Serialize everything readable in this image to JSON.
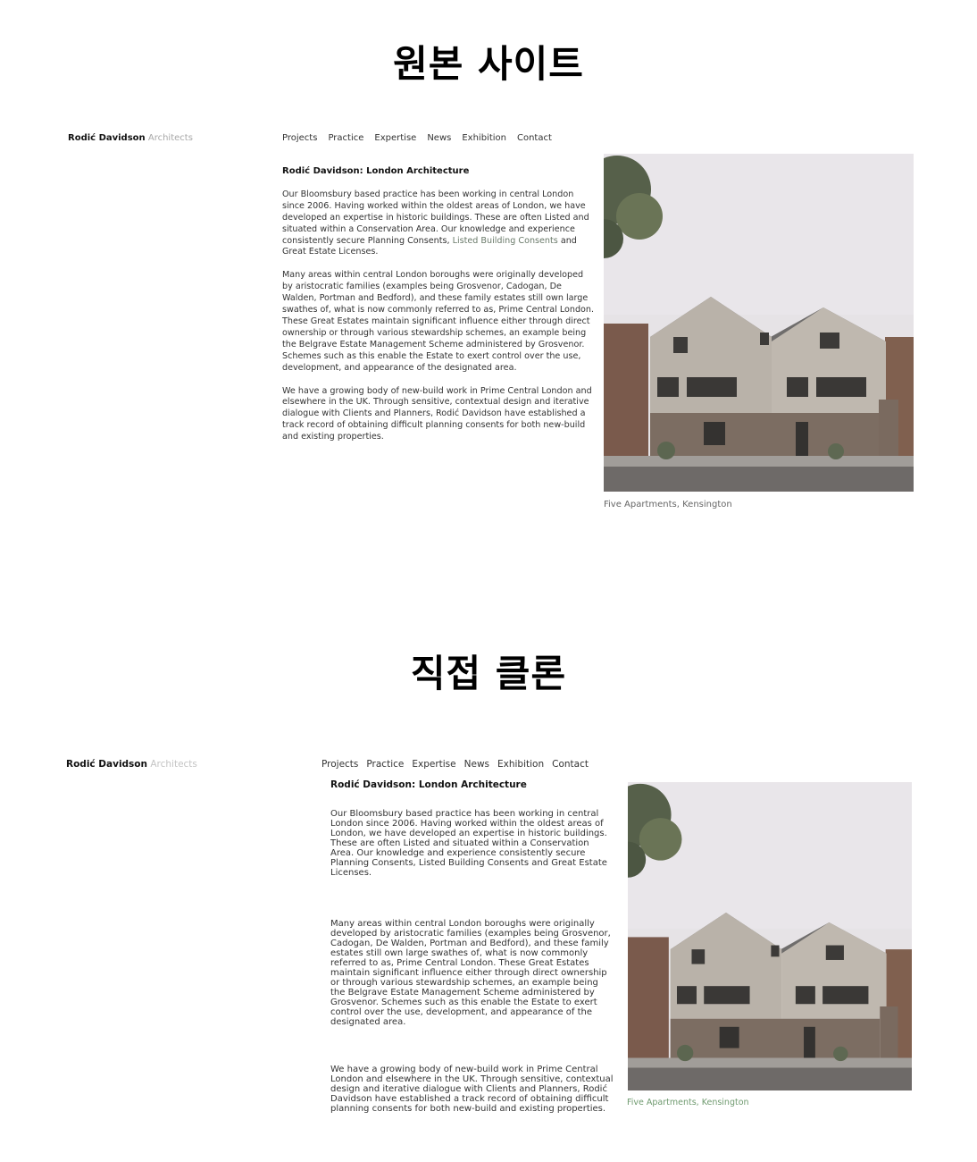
{
  "headings": {
    "original": "원본 사이트",
    "clone": "직접 클론"
  },
  "original": {
    "brand": {
      "name": "Rodić Davidson",
      "suffix": "Architects"
    },
    "nav": [
      "Projects",
      "Practice",
      "Expertise",
      "News",
      "Exhibition",
      "Contact"
    ],
    "article": {
      "title": "Rodić Davidson: London Architecture",
      "p1_before": "Our Bloomsbury based practice has been working in central London since 2006. Having worked within the oldest areas of London, we have developed an expertise in historic buildings. These are often Listed and situated within a Conservation Area. Our knowledge and experience consistently secure Planning Consents, ",
      "p1_link": "Listed Building Consents",
      "p1_after": " and Great Estate Licenses.",
      "p2": "Many areas within central London boroughs were originally developed by aristocratic families (examples being Grosvenor, Cadogan, De Walden, Portman and Bedford), and these family estates still own large swathes of, what is now commonly referred to as, Prime Central London. These Great Estates maintain significant influence either through direct ownership or through various stewardship schemes, an example being the Belgrave Estate Management Scheme administered by Grosvenor. Schemes such as this enable the Estate to exert control over the use, development, and appearance of the designated area.",
      "p3": "We have a growing body of new-build work in Prime Central London and elsewhere in the UK.  Through sensitive, contextual design and iterative dialogue with Clients and Planners, Rodić Davidson have established a track record of obtaining difficult planning consents for both new-build and existing properties."
    },
    "caption": "Five Apartments, Kensington"
  },
  "clone": {
    "brand": {
      "name": "Rodić Davidson",
      "suffix": "Architects"
    },
    "nav": [
      "Projects",
      "Practice",
      "Expertise",
      "News",
      "Exhibition",
      "Contact"
    ],
    "article": {
      "title": "Rodić Davidson: London Architecture",
      "p1": "Our Bloomsbury based practice has been working in central London since 2006. Having worked within the oldest areas of London, we have developed an expertise in historic buildings. These are often Listed and situated within a Conservation Area. Our knowledge and experience consistently secure Planning Consents, Listed Building Consents and Great Estate Licenses.",
      "p2": "Many areas within central London boroughs were originally developed by aristocratic families (examples being Grosvenor, Cadogan, De Walden, Portman and Bedford), and these family estates still own large swathes of, what is now commonly referred to as, Prime Central London. These Great Estates maintain significant influence either through direct ownership or through various stewardship schemes, an example being the Belgrave Estate Management Scheme administered by Grosvenor. Schemes such as this enable the Estate to exert control over the use, development, and appearance of the designated area.",
      "p3": "We have a growing body of new-build work in Prime Central London and elsewhere in the UK. Through sensitive, contextual design and iterative dialogue with Clients and Planners, Rodić Davidson have established a track record of obtaining difficult planning consents for both new-build and existing properties."
    },
    "caption": "Five Apartments, Kensington"
  }
}
